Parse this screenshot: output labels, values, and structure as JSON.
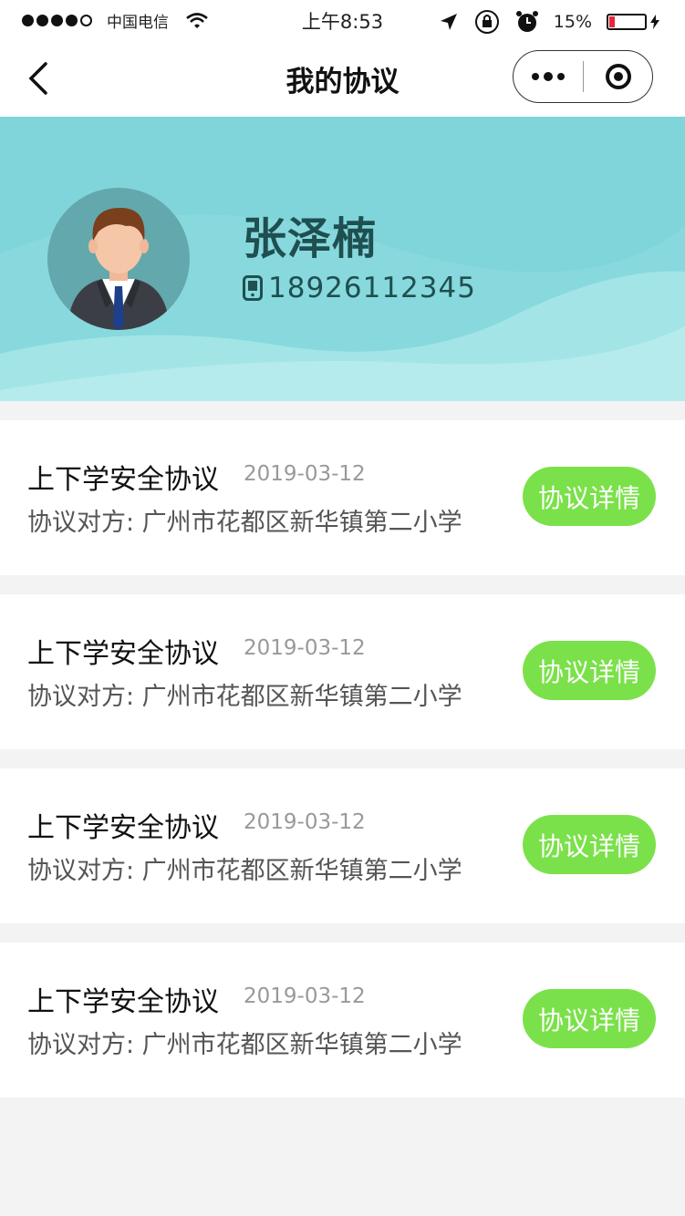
{
  "status_bar": {
    "carrier": "中国电信",
    "time": "上午8:53",
    "battery_percent": "15%",
    "battery_level": 0.15,
    "icons": [
      "signal-dots-icon",
      "wifi-icon",
      "location-arrow-icon",
      "orientation-lock-icon",
      "alarm-icon",
      "battery-icon",
      "charging-icon"
    ]
  },
  "nav": {
    "title": "我的协议",
    "back_icon": "chevron-left-icon",
    "more_icon": "more-dots-icon",
    "close_icon": "target-close-icon"
  },
  "profile": {
    "name": "张泽楠",
    "phone": "18926112345",
    "phone_icon": "mobile-phone-icon"
  },
  "agreements": [
    {
      "title": "上下学安全协议",
      "date": "2019-03-12",
      "party": "协议对方: 广州市花都区新华镇第二小学",
      "button": "协议详情"
    },
    {
      "title": "上下学安全协议",
      "date": "2019-03-12",
      "party": "协议对方: 广州市花都区新华镇第二小学",
      "button": "协议详情"
    },
    {
      "title": "上下学安全协议",
      "date": "2019-03-12",
      "party": "协议对方: 广州市花都区新华镇第二小学",
      "button": "协议详情"
    },
    {
      "title": "上下学安全协议",
      "date": "2019-03-12",
      "party": "协议对方: 广州市花都区新华镇第二小学",
      "button": "协议详情"
    }
  ],
  "colors": {
    "header_bg": "#7fd5da",
    "button_bg": "#7be14a",
    "name_text": "#1f4f51",
    "page_bg": "#f3f3f3"
  }
}
